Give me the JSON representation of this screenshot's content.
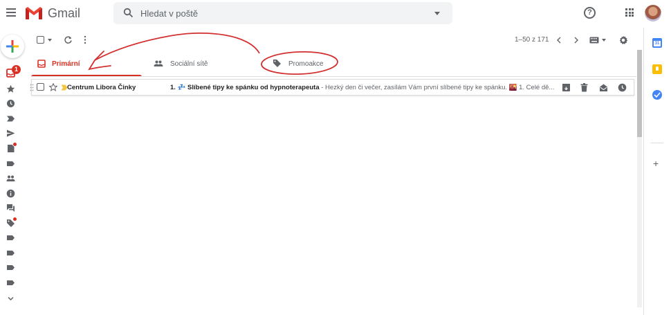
{
  "header": {
    "app_name": "Gmail",
    "search_placeholder": "Hledat v poště"
  },
  "left_rail": {
    "inbox_badge_count": "1"
  },
  "toolbar": {
    "page_count": "1–50 z 171"
  },
  "tabs": [
    {
      "label": "Primární",
      "active": true
    },
    {
      "label": "Sociální sítě",
      "active": false
    },
    {
      "label": "Promoakce",
      "active": false
    }
  ],
  "emails": [
    {
      "sender": "Centrum Libora Činky",
      "subject": "1. 💤 Slíbené tipy ke spánku od hypnoterapeuta",
      "snippet": " - Hezký den či večer, zasílám Vám první slíbené tipy ke spánku. 🌇 1. Celé dě..."
    }
  ],
  "colors": {
    "accent_red": "#d93025",
    "annotation_red": "#d32f2f",
    "icon_gray": "#5f6368"
  }
}
